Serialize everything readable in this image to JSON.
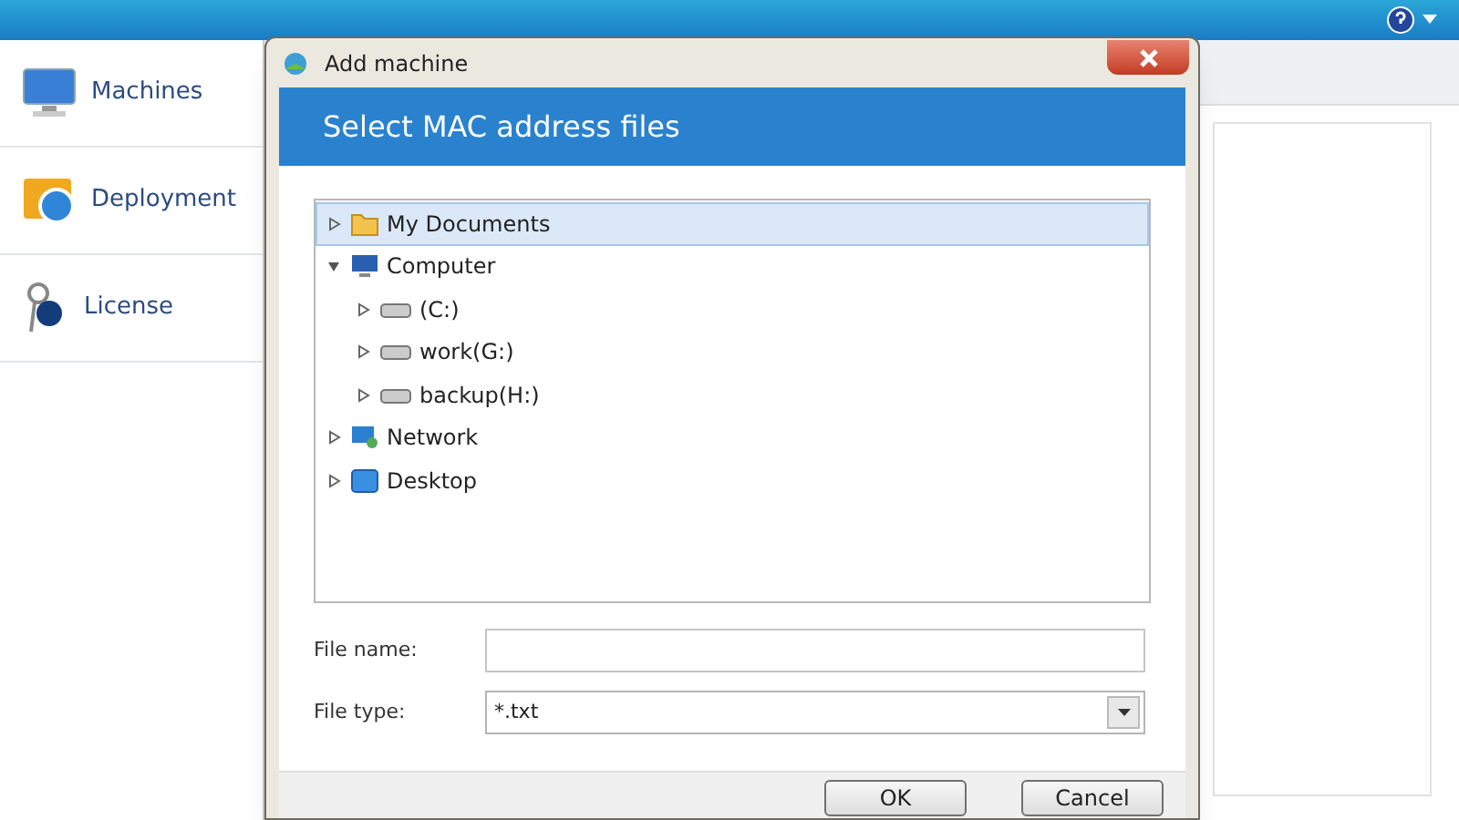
{
  "sidebar": {
    "items": [
      {
        "label": "Machines",
        "kind": "monitor",
        "selected": false
      },
      {
        "label": "Deployment",
        "kind": "deploy",
        "selected": false
      },
      {
        "label": "License",
        "kind": "key",
        "selected": false
      }
    ]
  },
  "dialog": {
    "title": "Add machine",
    "header": "Select MAC address files",
    "tree": [
      {
        "label": "My Documents",
        "kind": "folder",
        "selected": true,
        "expanded": false
      },
      {
        "label": "Computer",
        "kind": "computer",
        "selected": false,
        "expanded": true,
        "children": [
          {
            "label": "(C:)",
            "kind": "drive",
            "selected": false,
            "expanded": false
          },
          {
            "label": "work(G:)",
            "kind": "drive",
            "selected": false,
            "expanded": false
          },
          {
            "label": "backup(H:)",
            "kind": "drive",
            "selected": false,
            "expanded": false
          }
        ]
      },
      {
        "label": "Network",
        "kind": "network",
        "selected": false,
        "expanded": false
      },
      {
        "label": "Desktop",
        "kind": "desktop",
        "selected": false,
        "expanded": false
      }
    ],
    "fields": [
      {
        "label": "File name:",
        "kind": "text"
      },
      {
        "label": "File type:",
        "kind": "select",
        "value": "*.txt"
      }
    ],
    "buttons": [
      "OK",
      "Cancel"
    ]
  }
}
